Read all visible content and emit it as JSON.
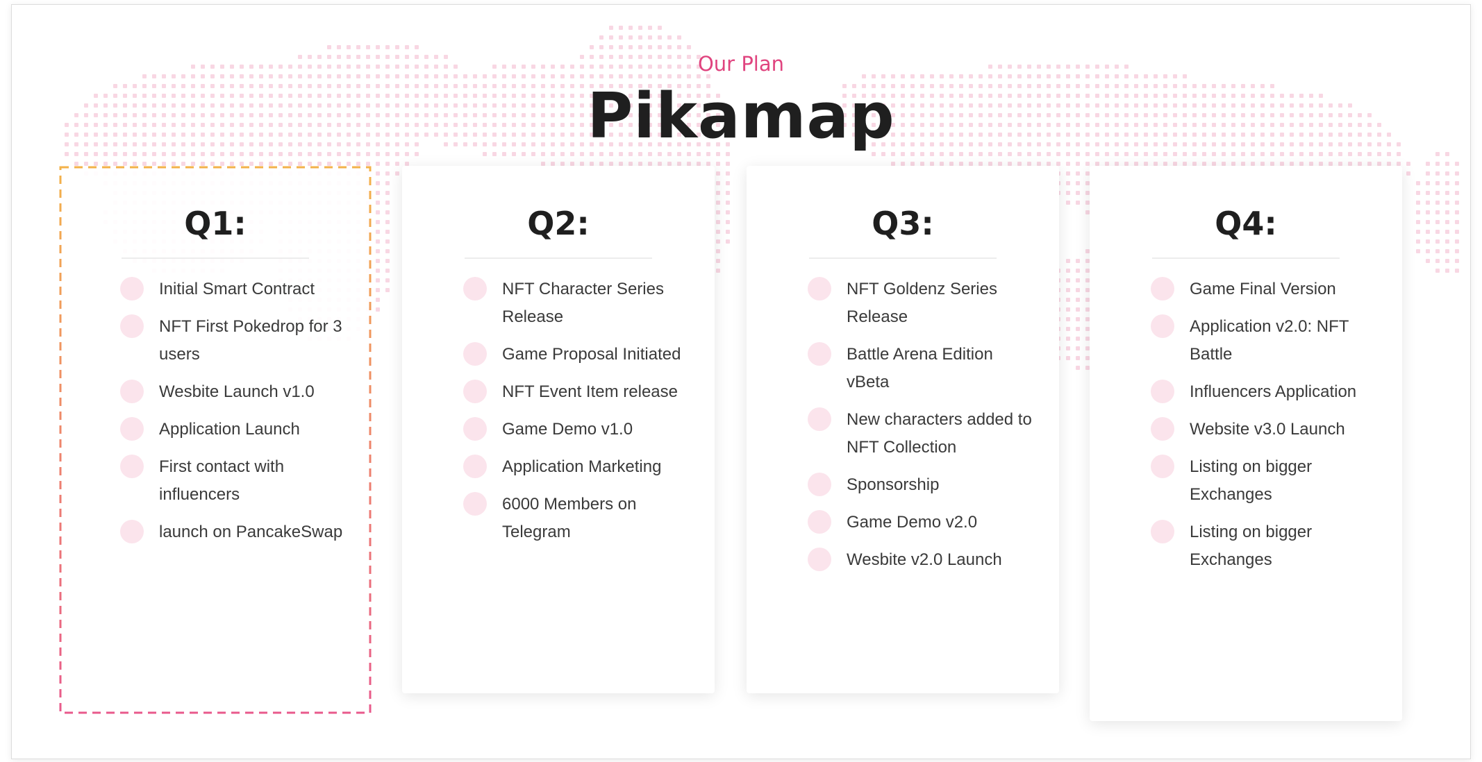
{
  "section": {
    "kicker": "Our Plan",
    "title": "Pikamap"
  },
  "colors": {
    "accent": "#e0447f",
    "dot": "#fbe4ec",
    "map_dots": "#f8d7e3",
    "q1_border_top": "#f3b24a",
    "q1_border_bottom": "#e85a8c"
  },
  "quarters": [
    {
      "label": "Q1:",
      "items": [
        "Initial Smart Contract",
        "NFT First Pokedrop for 3 users",
        "Wesbite Launch v1.0",
        "Application Launch",
        "First contact with influencers",
        "launch on PancakeSwap"
      ]
    },
    {
      "label": "Q2:",
      "items": [
        "NFT Character Series Release",
        "Game Proposal Initiated",
        "NFT Event Item release",
        "Game Demo v1.0",
        "Application Marketing",
        "6000 Members on Telegram"
      ]
    },
    {
      "label": "Q3:",
      "items": [
        "NFT Goldenz Series Release",
        "Battle Arena Edition vBeta",
        "New characters added to NFT Collection",
        "Sponsorship",
        "Game Demo v2.0",
        "Wesbite v2.0 Launch"
      ]
    },
    {
      "label": "Q4:",
      "items": [
        "Game Final Version",
        "Application v2.0: NFT Battle",
        "Influencers Application",
        "Website v3.0 Launch",
        "Listing on bigger Exchanges",
        "Listing on bigger Exchanges"
      ]
    }
  ]
}
